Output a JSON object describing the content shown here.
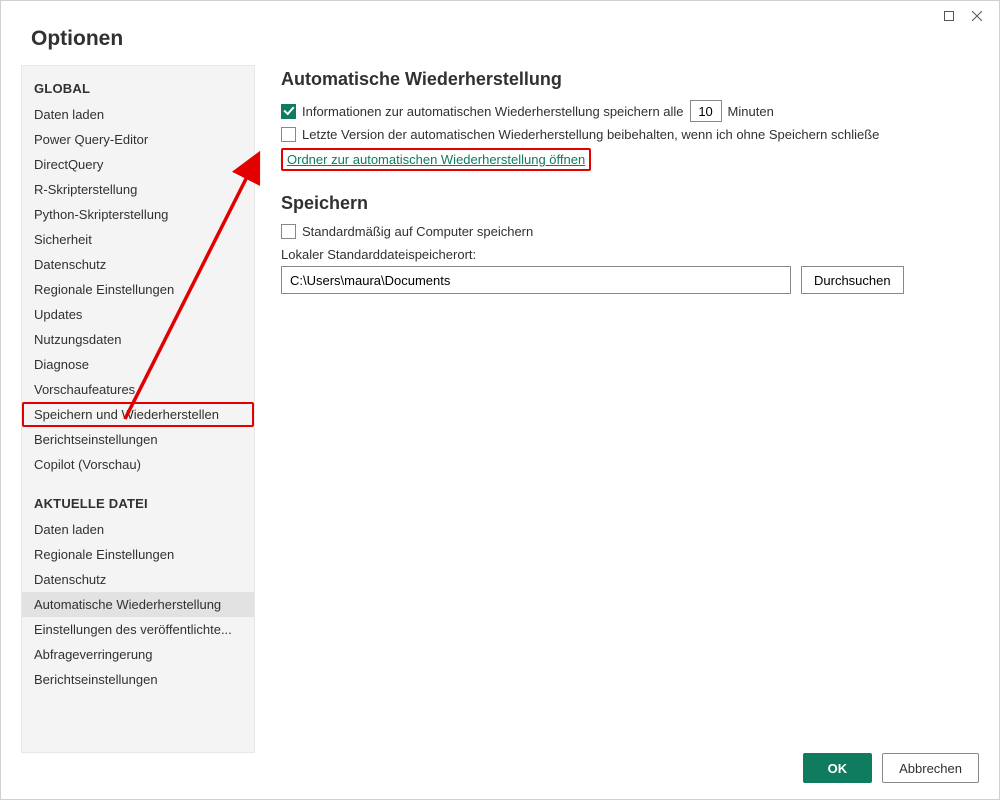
{
  "window": {
    "title": "Optionen"
  },
  "sidebar": {
    "global_header": "GLOBAL",
    "global_items": [
      "Daten laden",
      "Power Query-Editor",
      "DirectQuery",
      "R-Skripterstellung",
      "Python-Skripterstellung",
      "Sicherheit",
      "Datenschutz",
      "Regionale Einstellungen",
      "Updates",
      "Nutzungsdaten",
      "Diagnose",
      "Vorschaufeatures",
      "Speichern und Wiederherstellen",
      "Berichtseinstellungen",
      "Copilot (Vorschau)"
    ],
    "current_header": "AKTUELLE DATEI",
    "current_items": [
      "Daten laden",
      "Regionale Einstellungen",
      "Datenschutz",
      "Automatische Wiederherstellung",
      "Einstellungen des veröffentlichte...",
      "Abfrageverringerung",
      "Berichtseinstellungen"
    ],
    "selected_global_index": 12,
    "selected_current_index": 3
  },
  "content": {
    "autorecover": {
      "title": "Automatische Wiederherstellung",
      "store_info_prefix": "Informationen zur automatischen Wiederherstellung speichern alle",
      "interval_value": "10",
      "store_info_suffix": "Minuten",
      "store_info_checked": true,
      "keep_last_label": "Letzte Version der automatischen Wiederherstellung beibehalten, wenn ich ohne Speichern schließe",
      "keep_last_checked": false,
      "open_folder_link": "Ordner zur automatischen Wiederherstellung öffnen"
    },
    "save": {
      "title": "Speichern",
      "save_to_computer_label": "Standardmäßig auf Computer speichern",
      "save_to_computer_checked": false,
      "default_location_label": "Lokaler Standarddateispeicherort:",
      "default_location_value": "C:\\Users\\maura\\Documents",
      "browse_label": "Durchsuchen"
    }
  },
  "footer": {
    "ok": "OK",
    "cancel": "Abbrechen"
  },
  "colors": {
    "accent": "#0f7b5f",
    "highlight": "#e20000"
  }
}
